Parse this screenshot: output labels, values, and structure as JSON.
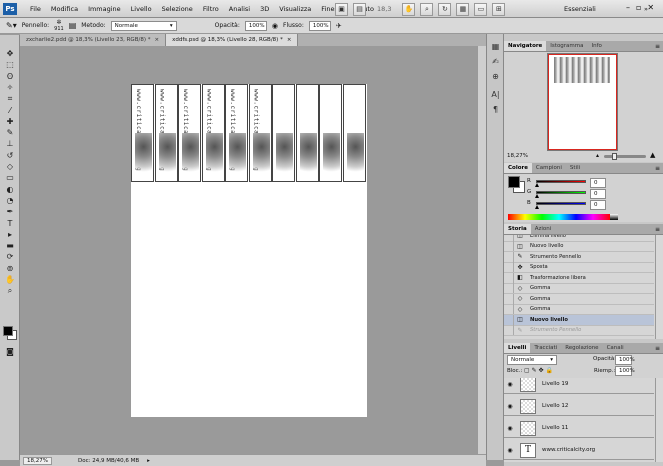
{
  "app": {
    "logo": "Ps"
  },
  "menu": [
    "File",
    "Modifica",
    "Immagine",
    "Livello",
    "Selezione",
    "Filtro",
    "Analisi",
    "3D",
    "Visualizza",
    "Finestra",
    "Aiuto"
  ],
  "toolbar_top": {
    "zoom": "18,3",
    "workspace": "Essenziali"
  },
  "options": {
    "brush_label": "Pennello:",
    "brush_size": "911",
    "mode_label": "Metodo:",
    "mode_value": "Normale",
    "opacity_label": "Opacità:",
    "opacity_value": "100%",
    "flow_label": "Flusso:",
    "flow_value": "100%"
  },
  "tabs": [
    {
      "label": "zxcharlie2.pdd @ 18,3% (Livello 23, RGB/8) *",
      "active": false
    },
    {
      "label": "xddfs.psd @ 18,3% (Livello 28, RGB/8) *",
      "active": true
    }
  ],
  "strip_text": [
    "www.criticalcity.org",
    "www.criticalcity.org",
    "www.criticalcity.org",
    "www.criticalcity.org",
    "www.criticalcity.org",
    "www.criticalcity.org"
  ],
  "status": {
    "zoom": "18,27%",
    "doc": "Doc: 24,9 MB/40,6 MB"
  },
  "navigator": {
    "tabs": [
      "Navigatore",
      "Istogramma",
      "Info"
    ],
    "zoom": "18,27%"
  },
  "color": {
    "tabs": [
      "Colore",
      "Campioni",
      "Stili"
    ],
    "channels": [
      {
        "label": "R",
        "value": "0"
      },
      {
        "label": "G",
        "value": "0"
      },
      {
        "label": "B",
        "value": "0"
      }
    ]
  },
  "history": {
    "tabs": [
      "Storia",
      "Azioni"
    ],
    "items": [
      {
        "label": "Elimina livello",
        "icon": "◫"
      },
      {
        "label": "Nuovo livello",
        "icon": "◫"
      },
      {
        "label": "Strumento Pennello",
        "icon": "✎"
      },
      {
        "label": "Sposta",
        "icon": "✥"
      },
      {
        "label": "Trasformazione libera",
        "icon": "◧"
      },
      {
        "label": "Gomma",
        "icon": "◇"
      },
      {
        "label": "Gomma",
        "icon": "◇"
      },
      {
        "label": "Gomma",
        "icon": "◇"
      },
      {
        "label": "Nuovo livello",
        "icon": "◫"
      },
      {
        "label": "Strumento Pennello",
        "icon": "✎"
      }
    ]
  },
  "layers": {
    "tabs": [
      "Livelli",
      "Tracciati",
      "Regolazione",
      "Canali"
    ],
    "mode": "Normale",
    "opacity_label": "Opacità:",
    "opacity": "100%",
    "lock_label": "Bloc.:",
    "fill_label": "Riemp.:",
    "fill": "100%",
    "items": [
      {
        "name": "Livello 19",
        "thumb": ""
      },
      {
        "name": "Livello 12",
        "thumb": ""
      },
      {
        "name": "Livello 11",
        "thumb": ""
      },
      {
        "name": "www.criticalcity.org",
        "thumb": "T"
      }
    ]
  },
  "colors": {
    "accent": "#1c5fa8",
    "selection": "#b9c4d8",
    "canvas_bg": "#9a9a9a"
  }
}
